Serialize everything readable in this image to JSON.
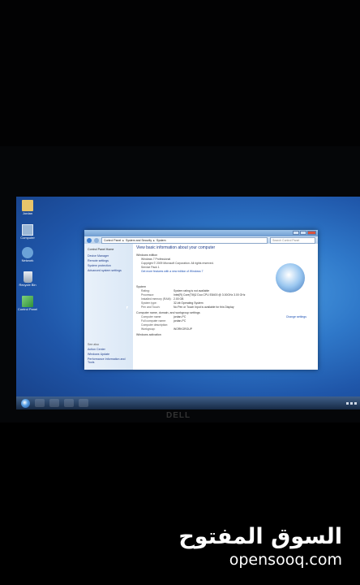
{
  "desktop": {
    "icons": [
      {
        "label": "Jordan",
        "icon": "user-folder-icon"
      },
      {
        "label": "Computer",
        "icon": "computer-icon"
      },
      {
        "label": "Network",
        "icon": "network-icon"
      },
      {
        "label": "Recycle Bin",
        "icon": "recycle-bin-icon"
      },
      {
        "label": "Control Panel",
        "icon": "control-panel-icon"
      }
    ]
  },
  "window": {
    "breadcrumb": [
      "Control Panel",
      "System and Security",
      "System"
    ],
    "search_placeholder": "Search Control Panel",
    "left_pane": {
      "home": "Control Panel Home",
      "links": [
        "Device Manager",
        "Remote settings",
        "System protection",
        "Advanced system settings"
      ],
      "see_also_title": "See also",
      "see_also": [
        "Action Center",
        "Windows Update",
        "Performance Information and Tools"
      ]
    },
    "main": {
      "title": "View basic information about your computer",
      "edition_header": "Windows edition",
      "edition": "Windows 7 Professional",
      "copyright": "Copyright © 2009 Microsoft Corporation. All rights reserved.",
      "service_pack": "Service Pack 1",
      "more_features": "Get more features with a new edition of Windows 7",
      "system_header": "System",
      "system_rows": [
        {
          "key": "Rating:",
          "value": "System rating is not available"
        },
        {
          "key": "Processor:",
          "value": "Intel(R) Core(TM)2 Duo CPU E8400 @ 3.00GHz 3.00 GHz"
        },
        {
          "key": "Installed memory (RAM):",
          "value": "2.00 GB"
        },
        {
          "key": "System type:",
          "value": "32-bit Operating System"
        },
        {
          "key": "Pen and Touch:",
          "value": "No Pen or Touch Input is available for this Display"
        }
      ],
      "name_header": "Computer name, domain, and workgroup settings",
      "name_rows": [
        {
          "key": "Computer name:",
          "value": "jordan-PC"
        },
        {
          "key": "Full computer name:",
          "value": "jordan-PC"
        },
        {
          "key": "Computer description:",
          "value": ""
        },
        {
          "key": "Workgroup:",
          "value": "WORKGROUP"
        }
      ],
      "change_settings": "Change settings",
      "activation_header": "Windows activation"
    }
  },
  "bezel_logo": "DELL",
  "watermark": {
    "arabic": "السوق المفتوح",
    "english": "opensooq.com"
  },
  "colors": {
    "desktop_bg": "#2f78c9",
    "link": "#1a4fb3",
    "window_bg": "#ffffff"
  }
}
